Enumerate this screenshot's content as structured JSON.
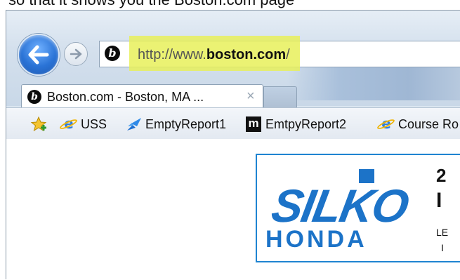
{
  "caption": "so that it shows you the Boston.com page",
  "nav": {
    "back_icon": "back-arrow-icon",
    "forward_icon": "forward-arrow-icon"
  },
  "address": {
    "url_prefix": "http://www.",
    "url_domain": "boston.com",
    "url_suffix": "/",
    "favicon_letter": "b"
  },
  "tab": {
    "title": "Boston.com - Boston, MA ...",
    "close": "×",
    "favicon_letter": "b"
  },
  "favorites": [
    {
      "label": "USS",
      "icon": "ie-icon"
    },
    {
      "label": "EmptyReport1",
      "icon": "powerbi-icon"
    },
    {
      "label": "EmtpyReport2",
      "icon": "m-icon"
    },
    {
      "label": "Course Ro",
      "icon": "ie-icon"
    }
  ],
  "ad": {
    "brand_top": "SILKO",
    "brand_bottom": "HONDA",
    "right_top": "2",
    "right_mid": "I",
    "right_low": "LE",
    "right_bottom": "I"
  },
  "colors": {
    "highlight": "#e8f05a",
    "accent_blue": "#1c73c8",
    "ad_border": "#1f84d1"
  }
}
